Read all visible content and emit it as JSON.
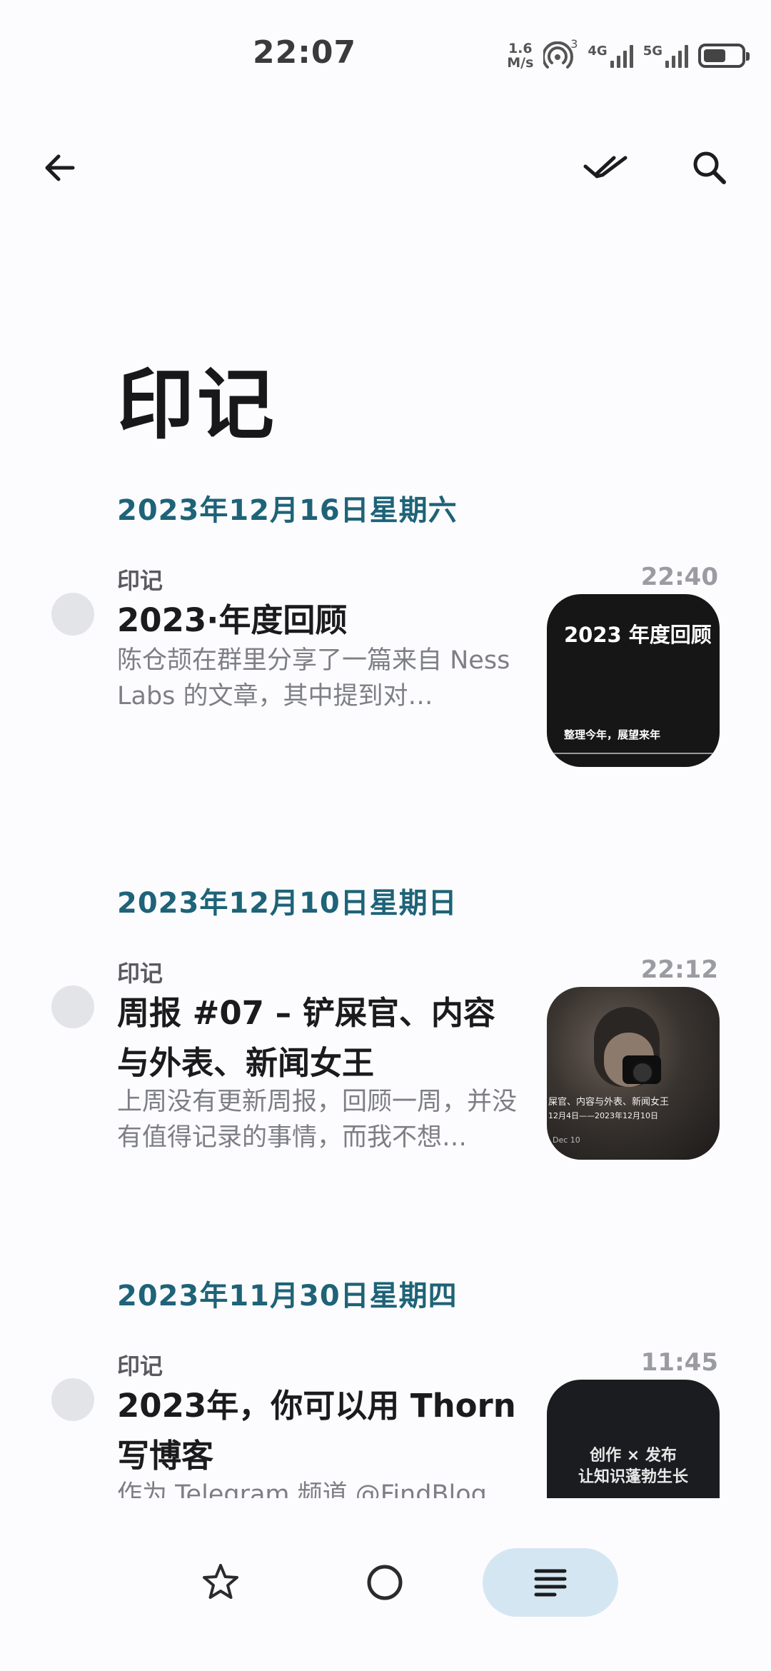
{
  "status_bar": {
    "time": "22:07",
    "net_speed_value": "1.6",
    "net_speed_unit": "M/s",
    "hotspot_count": "3",
    "sim1_label": "4G",
    "sim2_label": "5G",
    "battery_level": 0.6
  },
  "app_bar": {
    "back_icon": "arrow-left-icon",
    "mark_all_icon": "double-check-icon",
    "search_icon": "search-icon"
  },
  "page": {
    "title": "印记"
  },
  "feed": {
    "groups": [
      {
        "date": "2023年12月16日星期六",
        "entries": [
          {
            "tag": "印记",
            "time": "22:40",
            "title": "2023·年度回顾",
            "excerpt": "陈仓颉在群里分享了一篇来自 Ness Labs 的文章，其中提到对…",
            "thumb_title": "2023 年度回顾",
            "thumb_subtitle": "整理今年，展望来年"
          }
        ]
      },
      {
        "date": "2023年12月10日星期日",
        "entries": [
          {
            "tag": "印记",
            "time": "22:12",
            "title": "周报 #07 – 铲屎官、内容与外表、新闻女王",
            "excerpt": "上周没有更新周报，回顾一周，并没有值得记录的事情，而我不想…",
            "thumb_caption1": "屎官、内容与外表、新闻女王",
            "thumb_caption2": "12月4日——2023年12月10日",
            "thumb_caption3": "Dec 10"
          }
        ]
      },
      {
        "date": "2023年11月30日星期四",
        "entries": [
          {
            "tag": "印记",
            "time": "11:45",
            "title": "2023年，你可以用 Thorn 写博客",
            "excerpt": "作为 Telegram 频道 @FindBlog",
            "thumb_line1": "创作 × 发布",
            "thumb_line2": "让知识蓬勃生长"
          }
        ]
      }
    ]
  },
  "bottom_nav": {
    "items": [
      {
        "icon": "star-icon",
        "active": false
      },
      {
        "icon": "circle-icon",
        "active": false
      },
      {
        "icon": "list-icon",
        "active": true
      }
    ]
  },
  "colors": {
    "date_header": "#1e6378",
    "active_nav_bg": "#d5e6f3",
    "radio_bg": "#e3e4e7"
  }
}
